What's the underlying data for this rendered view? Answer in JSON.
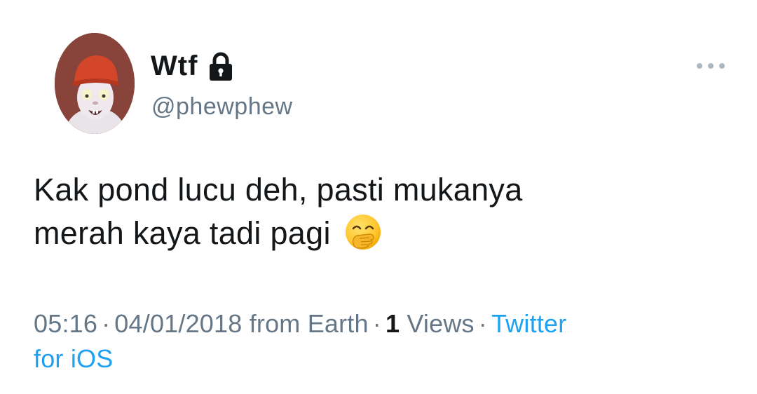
{
  "user": {
    "display_name": "Wtf",
    "handle": "@phewphew",
    "protected": true
  },
  "tweet": {
    "text_line1": "Kak pond lucu deh, pasti mukanya",
    "text_line2": "merah kaya tadi pagi",
    "emoji": "face-with-hand-over-mouth"
  },
  "meta": {
    "time": "05:16",
    "date": "04/01/2018",
    "location": "from Earth",
    "views_count": "1",
    "views_label": "Views",
    "source_part1": "Twitter",
    "source_part2": "for iOS",
    "separator": "·"
  },
  "colors": {
    "text": "#14171a",
    "secondary": "#657786",
    "link": "#1da1f2",
    "more_dots": "#aab8c2"
  },
  "icons": {
    "protected": "lock-icon",
    "more": "more-dots-icon"
  }
}
